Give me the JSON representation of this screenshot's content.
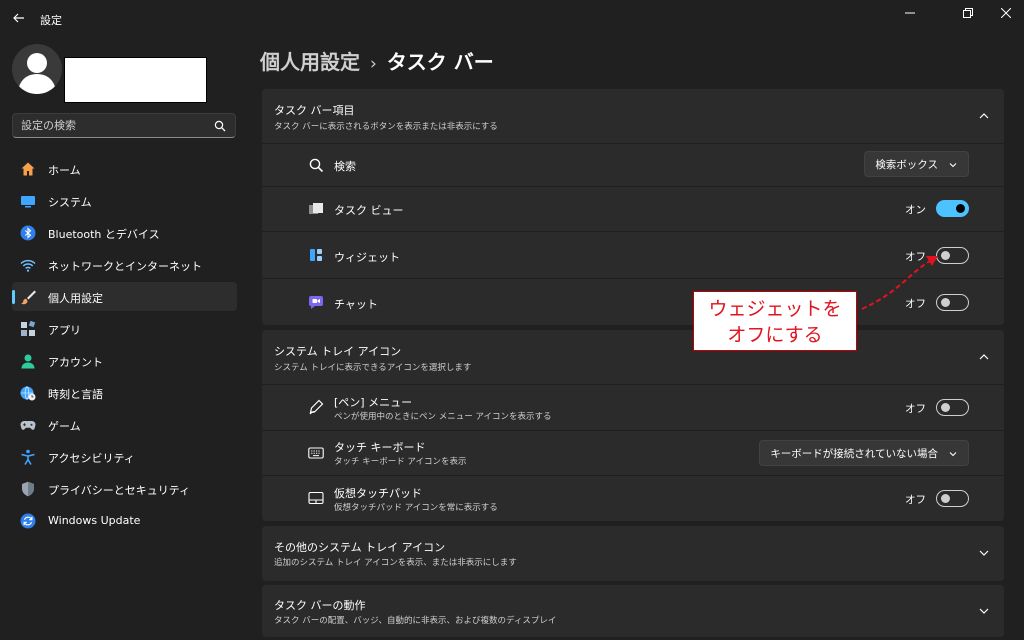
{
  "window": {
    "title": "設定"
  },
  "search": {
    "placeholder": "設定の検索"
  },
  "sidebar": {
    "items": [
      {
        "label": "ホーム",
        "icon": "home-icon"
      },
      {
        "label": "システム",
        "icon": "system-icon"
      },
      {
        "label": "Bluetooth とデバイス",
        "icon": "bluetooth-icon"
      },
      {
        "label": "ネットワークとインターネット",
        "icon": "network-icon"
      },
      {
        "label": "個人用設定",
        "icon": "brush-icon",
        "active": true
      },
      {
        "label": "アプリ",
        "icon": "apps-icon"
      },
      {
        "label": "アカウント",
        "icon": "account-icon"
      },
      {
        "label": "時刻と言語",
        "icon": "globe-clock-icon"
      },
      {
        "label": "ゲーム",
        "icon": "gamepad-icon"
      },
      {
        "label": "アクセシビリティ",
        "icon": "accessibility-icon"
      },
      {
        "label": "プライバシーとセキュリティ",
        "icon": "shield-icon"
      },
      {
        "label": "Windows Update",
        "icon": "update-icon"
      }
    ]
  },
  "breadcrumb": {
    "parent": "個人用設定",
    "separator": "›",
    "current": "タスク バー"
  },
  "taskbar_items": {
    "title": "タスク バー項目",
    "desc": "タスク バーに表示されるボタンを表示または非表示にする",
    "search": {
      "label": "検索",
      "value": "検索ボックス"
    },
    "taskview": {
      "label": "タスク ビュー",
      "state": "オン"
    },
    "widget": {
      "label": "ウィジェット",
      "state": "オフ"
    },
    "chat": {
      "label": "チャット",
      "state": "オフ"
    }
  },
  "tray_icons": {
    "title": "システム トレイ アイコン",
    "desc": "システム トレイに表示できるアイコンを選択します",
    "pen": {
      "label": "[ペン] メニュー",
      "sub": "ペンが使用中のときにペン メニュー アイコンを表示する",
      "state": "オフ"
    },
    "touchkb": {
      "label": "タッチ キーボード",
      "sub": "タッチ キーボード アイコンを表示",
      "value": "キーボードが接続されていない場合"
    },
    "touchpad": {
      "label": "仮想タッチパッド",
      "sub": "仮想タッチパッド アイコンを常に表示する",
      "state": "オフ"
    }
  },
  "other_tray": {
    "title": "その他のシステム トレイ アイコン",
    "desc": "追加のシステム トレイ アイコンを表示、または非表示にします"
  },
  "behavior": {
    "title": "タスク バーの動作",
    "desc": "タスク バーの配置、バッジ、自動的に非表示、および複数のディスプレイ"
  },
  "annotation": {
    "line1": "ウェジェットを",
    "line2": "オフにする"
  },
  "colors": {
    "accent": "#4cc2ff",
    "annotation": "#e0141e",
    "background": "#202020",
    "card": "#2b2b2b"
  }
}
